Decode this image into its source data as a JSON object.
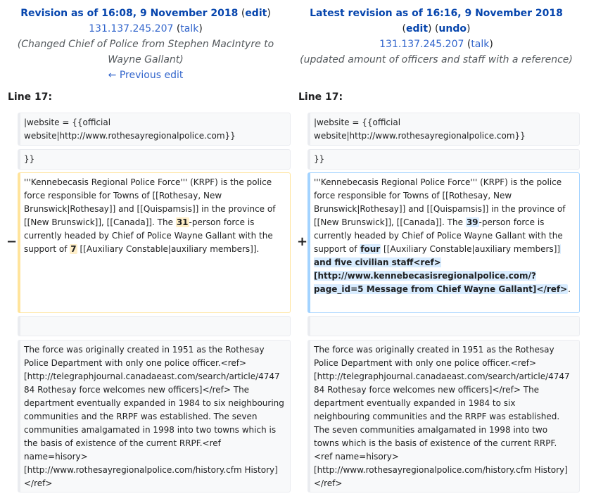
{
  "left": {
    "title": "Revision as of 16:08, 9 November 2018",
    "edit": "edit",
    "user": "131.137.245.207",
    "talk": "talk",
    "summary": "(Changed Chief of Police from Stephen MacIntyre to Wayne Gallant)",
    "prev_edit": "← Previous edit",
    "line_label": "Line 17:"
  },
  "right": {
    "title": "Latest revision as of 16:16, 9 November 2018",
    "edit": "edit",
    "undo": "undo",
    "user": "131.137.245.207",
    "talk": "talk",
    "summary": "(updated amount of officers and staff with a reference)",
    "line_label": "Line 17:"
  },
  "markers": {
    "minus": "−",
    "plus": "+"
  },
  "rows": {
    "website": "|website        = {{official website|http://www.rothesayregionalpolice.com}}",
    "close": "}}",
    "del": {
      "t1": "'''Kennebecasis Regional Police Force''' (KRPF) is the police force responsible for Towns of [[Rothesay, New Brunswick|Rothesay]] and [[Quispamsis]] in the province of [[New Brunswick]], [[Canada]]. The ",
      "h1": "31",
      "t2": "-person force is currently headed by Chief of Police Wayne Gallant with the support of ",
      "h2": "7",
      "t3": " [[Auxiliary Constable|auxiliary members]]."
    },
    "add": {
      "t1": "'''Kennebecasis Regional Police Force''' (KRPF) is the police force responsible for Towns of [[Rothesay, New Brunswick|Rothesay]] and [[Quispamsis]] in the province of [[New Brunswick]], [[Canada]]. The ",
      "h1": "39",
      "t2": "-person force is currently headed by Chief of Police Wayne Gallant with the support of ",
      "h2": "four",
      "t3": " [[Auxiliary Constable|auxiliary members]]",
      "h3": " and five civilian staff<ref>[http://www.kennebecasisregionalpolice.com/?page_id=5 Message from Chief Wayne Gallant]</ref>",
      "t4": "."
    },
    "history": "The force was originally created in 1951 as the Rothesay Police Department with only one police officer.<ref>[http://telegraphjournal.canadaeast.com/search/article/474784 Rothesay force welcomes new officers]</ref> The department eventually expanded in 1984 to six neighbouring communities and the RRPF was established. The seven communities amalgamated in 1998 into two towns which is the basis of existence of the current RRPF.<ref name=hisory>[http://www.rothesayregionalpolice.com/history.cfm History]</ref>"
  }
}
